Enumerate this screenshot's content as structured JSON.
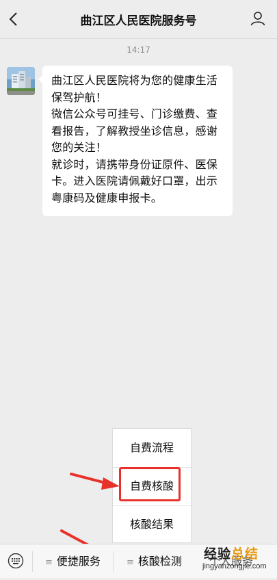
{
  "header": {
    "title": "曲江区人民医院服务号",
    "back_icon": "chevron-left-icon",
    "profile_icon": "person-icon"
  },
  "chat": {
    "timestamp": "14:17",
    "avatar_icon": "hospital-building-avatar",
    "message": {
      "line1": "曲江区人民医院将为您的健康生活保驾护航！",
      "line2": "微信公众号可挂号、门诊缴费、查看报告，了解教授坐诊信息，感谢您的关注！",
      "line3": "就诊时，请携带身份证原件、医保卡。进入医院请佩戴好口罩，出示粤康码及健康申报卡。"
    }
  },
  "popup_menu": {
    "items": [
      {
        "label": "自费流程"
      },
      {
        "label": "自费核酸"
      },
      {
        "label": "核酸结果"
      }
    ]
  },
  "bottom_bar": {
    "keyboard_icon": "keyboard-icon",
    "menu1": "便捷服务",
    "menu2": "核酸检测",
    "menu3": "个人服务"
  },
  "annotation": {
    "color": "#e8312a"
  },
  "watermark": {
    "logo_part1": "经验",
    "logo_part2": "总结",
    "url": "jingyanzongjie.com"
  }
}
